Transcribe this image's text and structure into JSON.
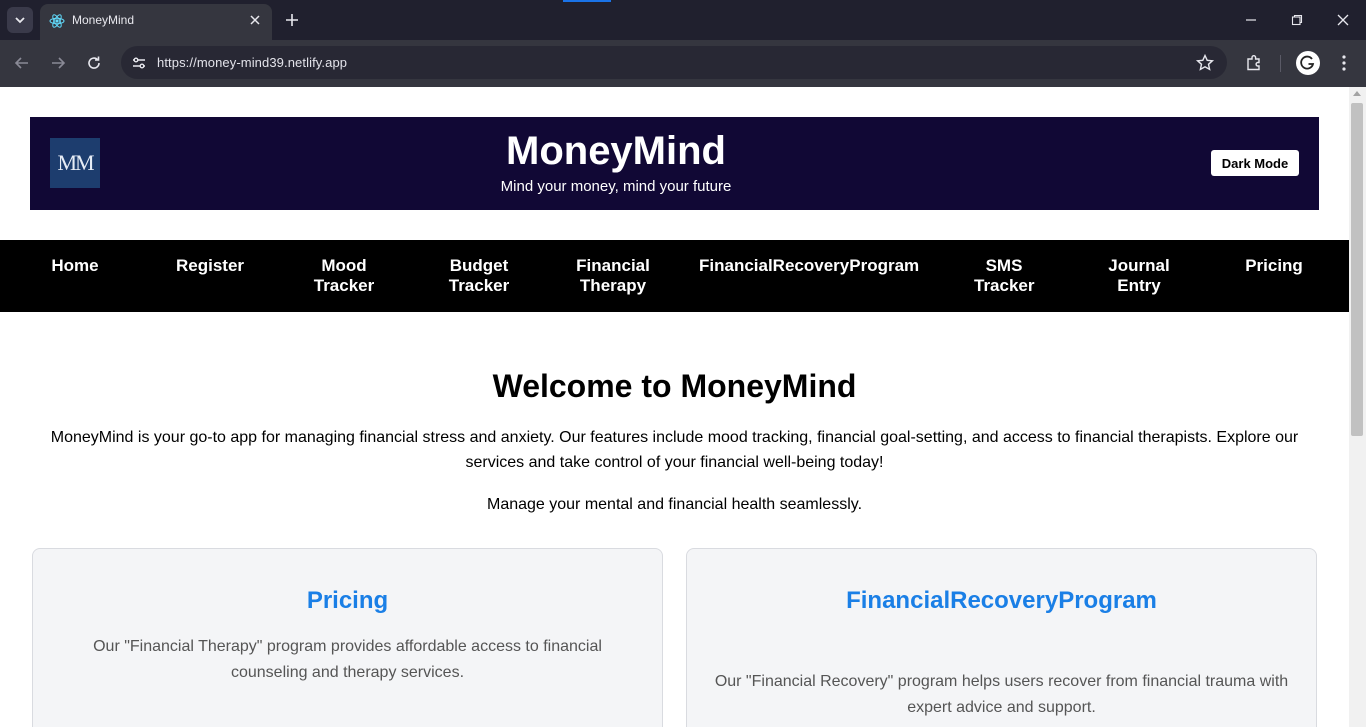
{
  "browser": {
    "tab_title": "MoneyMind",
    "url": "https://money-mind39.netlify.app"
  },
  "header": {
    "logo_text": "MM",
    "title": "MoneyMind",
    "tagline": "Mind your money, mind your future",
    "dark_mode_label": "Dark Mode",
    "background_color": "#110835"
  },
  "nav": {
    "items": [
      {
        "label": "Home"
      },
      {
        "label": "Register"
      },
      {
        "label": "Mood Tracker"
      },
      {
        "label": "Budget Tracker"
      },
      {
        "label": "Financial Therapy"
      },
      {
        "label": "FinancialRecoveryProgram"
      },
      {
        "label": "SMS Tracker"
      },
      {
        "label": "Journal Entry"
      },
      {
        "label": "Pricing"
      }
    ]
  },
  "welcome": {
    "title": "Welcome to MoneyMind",
    "description": "MoneyMind is your go-to app for managing financial stress and anxiety. Our features include mood tracking, financial goal-setting, and access to financial therapists. Explore our services and take control of your financial well-being today!",
    "subtitle": "Manage your mental and financial health seamlessly."
  },
  "cards": [
    {
      "title": "Pricing",
      "text": "Our \"Financial Therapy\" program provides affordable access to financial counseling and therapy services."
    },
    {
      "title": "FinancialRecoveryProgram",
      "text": "Our \"Financial Recovery\" program helps users recover from financial trauma with expert advice and support."
    }
  ],
  "colors": {
    "accent": "#1a7fe6",
    "nav_background": "#000000"
  }
}
